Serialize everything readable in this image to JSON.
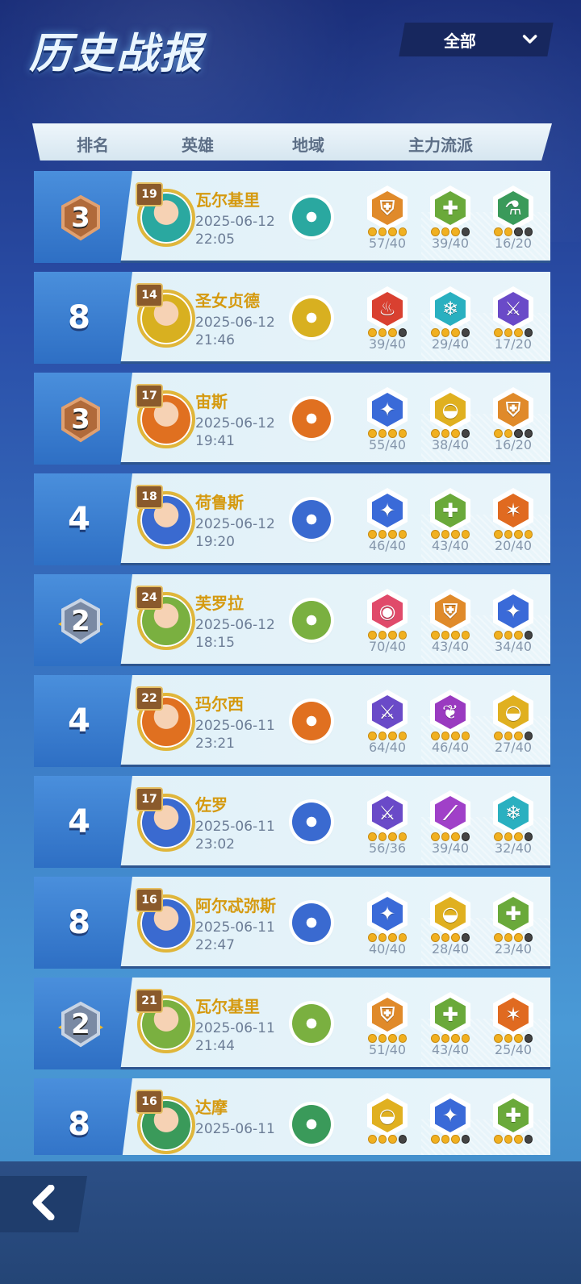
{
  "page_title": "历史战报",
  "filter": {
    "selected": "全部"
  },
  "columns": {
    "rank": "排名",
    "hero": "英雄",
    "region": "地域",
    "faction": "主力流派"
  },
  "rows": [
    {
      "rank": "3",
      "rank_style": "bronze",
      "level": "19",
      "hero": "瓦尔基里",
      "date": "2025-06-12",
      "time": "22:05",
      "region_icon": "trident-icon",
      "region_color": "#2aa8a0",
      "factions": [
        {
          "icon": "shield-icon",
          "color": "#e08a2a",
          "glyph": "⛨",
          "count": "57/40",
          "dots": 4
        },
        {
          "icon": "cross-icon",
          "color": "#6aa93a",
          "glyph": "✚",
          "count": "39/40",
          "dots": 3
        },
        {
          "icon": "potion-icon",
          "color": "#3a9a5a",
          "glyph": "⚗",
          "count": "16/20",
          "dots": 2
        }
      ]
    },
    {
      "rank": "8",
      "rank_style": "plain",
      "level": "14",
      "hero": "圣女贞德",
      "date": "2025-06-12",
      "time": "21:46",
      "region_icon": "swirl-icon",
      "region_color": "#d8b020",
      "factions": [
        {
          "icon": "flame-icon",
          "color": "#d94030",
          "glyph": "♨",
          "count": "39/40",
          "dots": 3
        },
        {
          "icon": "snowflake-icon",
          "color": "#2ab0c0",
          "glyph": "❄",
          "count": "29/40",
          "dots": 3
        },
        {
          "icon": "sword-icon",
          "color": "#6a4ac8",
          "glyph": "⚔",
          "count": "17/20",
          "dots": 3
        }
      ]
    },
    {
      "rank": "3",
      "rank_style": "bronze",
      "level": "17",
      "hero": "宙斯",
      "date": "2025-06-12",
      "time": "19:41",
      "region_icon": "axe-icon",
      "region_color": "#e07020",
      "factions": [
        {
          "icon": "star-icon",
          "color": "#3a6ad8",
          "glyph": "✦",
          "count": "55/40",
          "dots": 4
        },
        {
          "icon": "arm-icon",
          "color": "#e0b020",
          "glyph": "◒",
          "count": "38/40",
          "dots": 3
        },
        {
          "icon": "shield-icon",
          "color": "#e08a2a",
          "glyph": "⛨",
          "count": "16/20",
          "dots": 2
        }
      ]
    },
    {
      "rank": "4",
      "rank_style": "plain",
      "level": "18",
      "hero": "荷鲁斯",
      "date": "2025-06-12",
      "time": "19:20",
      "region_icon": "wings-icon",
      "region_color": "#3a6ad0",
      "factions": [
        {
          "icon": "star-icon",
          "color": "#3a6ad8",
          "glyph": "✦",
          "count": "46/40",
          "dots": 4
        },
        {
          "icon": "cross-icon",
          "color": "#6aa93a",
          "glyph": "✚",
          "count": "43/40",
          "dots": 4
        },
        {
          "icon": "spear-icon",
          "color": "#e06a20",
          "glyph": "✶",
          "count": "20/40",
          "dots": 4
        }
      ]
    },
    {
      "rank": "2",
      "rank_style": "silver",
      "level": "24",
      "hero": "芙罗拉",
      "date": "2025-06-12",
      "time": "18:15",
      "region_icon": "pentagram-icon",
      "region_color": "#7ab040",
      "factions": [
        {
          "icon": "orb-icon",
          "color": "#e04a6a",
          "glyph": "◉",
          "count": "70/40",
          "dots": 4
        },
        {
          "icon": "shield-icon",
          "color": "#e08a2a",
          "glyph": "⛨",
          "count": "43/40",
          "dots": 4
        },
        {
          "icon": "star-icon",
          "color": "#3a6ad8",
          "glyph": "✦",
          "count": "34/40",
          "dots": 3
        }
      ]
    },
    {
      "rank": "4",
      "rank_style": "plain",
      "level": "22",
      "hero": "玛尔西",
      "date": "2025-06-11",
      "time": "23:21",
      "region_icon": "axe-icon",
      "region_color": "#e07020",
      "factions": [
        {
          "icon": "sword-icon",
          "color": "#6a4ac8",
          "glyph": "⚔",
          "count": "64/40",
          "dots": 4
        },
        {
          "icon": "leaf-icon",
          "color": "#9a3ac0",
          "glyph": "❦",
          "count": "46/40",
          "dots": 4
        },
        {
          "icon": "arm-icon",
          "color": "#e0b020",
          "glyph": "◒",
          "count": "27/40",
          "dots": 3
        }
      ]
    },
    {
      "rank": "4",
      "rank_style": "plain",
      "level": "17",
      "hero": "佐罗",
      "date": "2025-06-11",
      "time": "23:02",
      "region_icon": "wings-icon",
      "region_color": "#3a6ad0",
      "factions": [
        {
          "icon": "sword-icon",
          "color": "#6a4ac8",
          "glyph": "⚔",
          "count": "56/36",
          "dots": 4
        },
        {
          "icon": "claw-icon",
          "color": "#a040c8",
          "glyph": "⟋",
          "count": "39/40",
          "dots": 3
        },
        {
          "icon": "snowflake-icon",
          "color": "#2ab0c0",
          "glyph": "❄",
          "count": "32/40",
          "dots": 3
        }
      ]
    },
    {
      "rank": "8",
      "rank_style": "plain",
      "level": "16",
      "hero": "阿尔忒弥斯",
      "date": "2025-06-11",
      "time": "22:47",
      "region_icon": "wings-icon",
      "region_color": "#3a6ad0",
      "factions": [
        {
          "icon": "star-icon",
          "color": "#3a6ad8",
          "glyph": "✦",
          "count": "40/40",
          "dots": 4
        },
        {
          "icon": "arm-icon",
          "color": "#e0b020",
          "glyph": "◒",
          "count": "28/40",
          "dots": 3
        },
        {
          "icon": "cross-icon",
          "color": "#6aa93a",
          "glyph": "✚",
          "count": "23/40",
          "dots": 3
        }
      ]
    },
    {
      "rank": "2",
      "rank_style": "silver",
      "level": "21",
      "hero": "瓦尔基里",
      "date": "2025-06-11",
      "time": "21:44",
      "region_icon": "pentagram-icon",
      "region_color": "#7ab040",
      "factions": [
        {
          "icon": "shield-icon",
          "color": "#e08a2a",
          "glyph": "⛨",
          "count": "51/40",
          "dots": 4
        },
        {
          "icon": "cross-icon",
          "color": "#6aa93a",
          "glyph": "✚",
          "count": "43/40",
          "dots": 4
        },
        {
          "icon": "spear-icon",
          "color": "#e06a20",
          "glyph": "✶",
          "count": "25/40",
          "dots": 3
        }
      ]
    },
    {
      "rank": "8",
      "rank_style": "plain",
      "level": "16",
      "hero": "达摩",
      "date": "2025-06-11",
      "time": "",
      "region_icon": "tree-icon",
      "region_color": "#3a9a5a",
      "factions": [
        {
          "icon": "arm-icon",
          "color": "#e0b020",
          "glyph": "◒",
          "count": "",
          "dots": 3
        },
        {
          "icon": "star-icon",
          "color": "#3a6ad8",
          "glyph": "✦",
          "count": "",
          "dots": 3
        },
        {
          "icon": "cross-icon",
          "color": "#6aa93a",
          "glyph": "✚",
          "count": "",
          "dots": 3
        }
      ]
    }
  ]
}
